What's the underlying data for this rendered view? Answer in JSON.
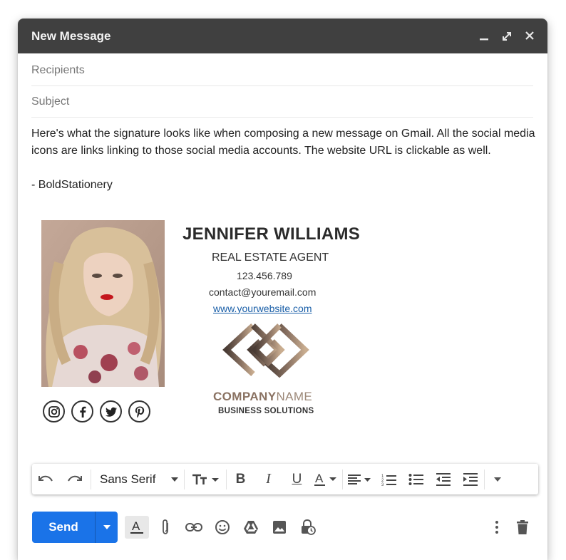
{
  "window": {
    "title": "New Message",
    "controls": [
      "minimize-icon",
      "expand-icon",
      "close-icon"
    ]
  },
  "fields": {
    "recipients_placeholder": "Recipients",
    "subject_placeholder": "Subject"
  },
  "body": {
    "paragraph": "Here's what the signature looks like when composing a new message on Gmail. All the social media icons are links linking to those social media accounts. The website URL is clickable as well.",
    "signoff": "- BoldStationery"
  },
  "signature": {
    "name": "JENNIFER WILLIAMS",
    "role": "REAL ESTATE AGENT",
    "phone": "123.456.789",
    "email": "contact@youremail.com",
    "website": "www.yourwebsite.com",
    "company_bold": "COMPANY",
    "company_light": "NAME",
    "company_tagline": "BUSINESS SOLUTIONS",
    "socials": [
      "instagram-icon",
      "facebook-icon",
      "twitter-icon",
      "pinterest-icon"
    ],
    "logo_colors": {
      "dark": "#4a3c35",
      "light": "#c9ad90"
    }
  },
  "format_toolbar": {
    "font": "Sans Serif",
    "icons": [
      "undo-icon",
      "redo-icon",
      "text-size-icon",
      "bold-icon",
      "italic-icon",
      "underline-icon",
      "text-color-icon",
      "align-icon",
      "numbered-list-icon",
      "bulleted-list-icon",
      "indent-less-icon",
      "indent-more-icon",
      "more-formatting-icon"
    ]
  },
  "actions": {
    "send_label": "Send",
    "accent": "#1a73e8"
  }
}
